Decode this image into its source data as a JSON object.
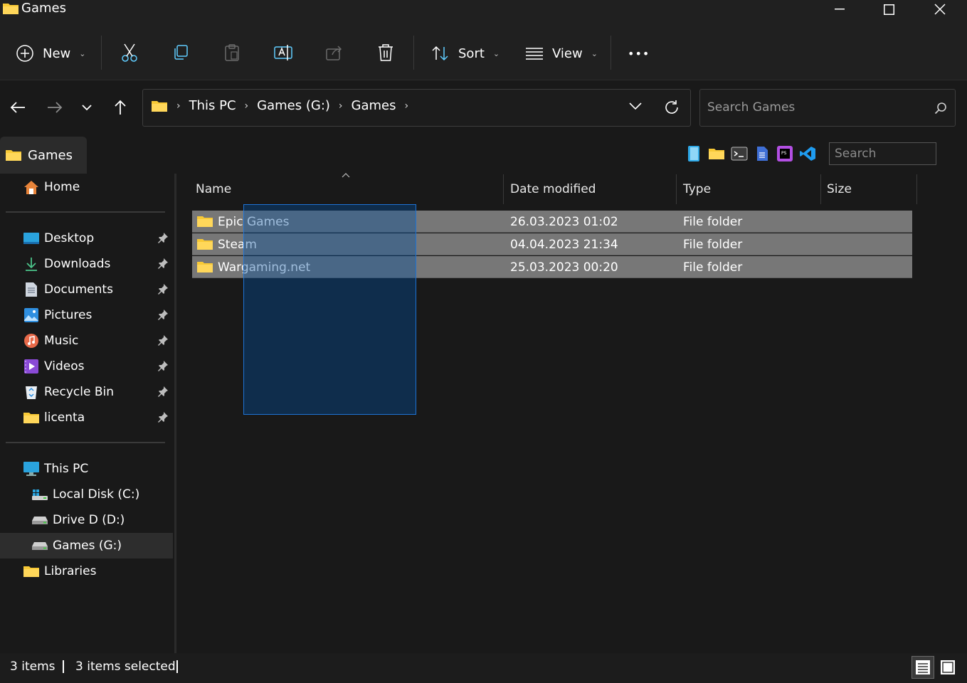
{
  "window": {
    "title": "Games"
  },
  "toolbar": {
    "new_label": "New",
    "sort_label": "Sort",
    "view_label": "View",
    "chevron": "⌄",
    "more": "•••"
  },
  "breadcrumb": {
    "items": [
      "This PC",
      "Games (G:)",
      "Games"
    ],
    "separator": "›"
  },
  "search": {
    "placeholder": "Search Games"
  },
  "tab": {
    "label": "Games"
  },
  "tab_toolbar": {
    "search_placeholder": "Search"
  },
  "sidebar": {
    "home": "Home",
    "quick_access": [
      "Desktop",
      "Downloads",
      "Documents",
      "Pictures",
      "Music",
      "Videos",
      "Recycle Bin",
      "licenta"
    ],
    "this_pc": "This PC",
    "drives": [
      "Local Disk (C:)",
      "Drive D (D:)",
      "Games (G:)"
    ],
    "libraries": "Libraries",
    "selected": "Games (G:)"
  },
  "columns": {
    "name": "Name",
    "date": "Date modified",
    "type": "Type",
    "size": "Size"
  },
  "files": [
    {
      "name": "Epic Games",
      "date": "26.03.2023 01:02",
      "type": "File folder"
    },
    {
      "name": "Steam",
      "date": "04.04.2023 21:34",
      "type": "File folder"
    },
    {
      "name": "Wargaming.net",
      "date": "25.03.2023 00:20",
      "type": "File folder"
    }
  ],
  "status": {
    "count": "3 items",
    "selected": "3 items selected"
  },
  "colors": {
    "background": "#191919",
    "chrome": "#202020",
    "selection_row": "#777777",
    "marquee_border": "#1e73d4",
    "folder_yellow": "#f8c936"
  }
}
